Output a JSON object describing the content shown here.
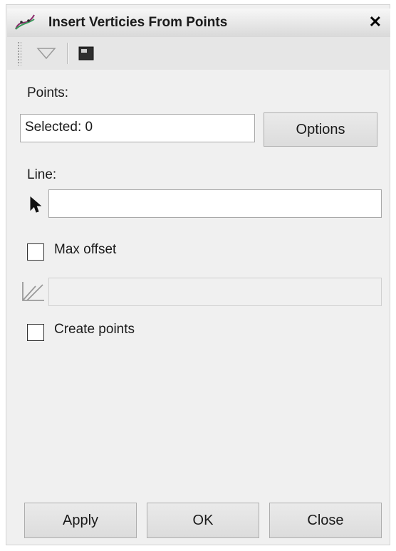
{
  "window": {
    "title": "Insert Verticies From Points",
    "close_glyph": "✕"
  },
  "icons": {
    "title": "line-points-icon",
    "toolbar_dropdown": "triangle-down-icon",
    "toolbar_console": "console-icon",
    "line_pick": "cursor-arrow-icon",
    "offset": "angle-icon",
    "close": "close-icon"
  },
  "points": {
    "label": "Points:",
    "value": "Selected: 0",
    "options_label": "Options"
  },
  "line": {
    "label": "Line:",
    "value": ""
  },
  "max_offset": {
    "label": "Max offset",
    "checked": false,
    "value": ""
  },
  "create_points": {
    "label": "Create points",
    "checked": false
  },
  "footer": {
    "apply_label": "Apply",
    "ok_label": "OK",
    "close_label": "Close"
  },
  "colors": {
    "window_bg": "#f0f0f0",
    "titlebar_bg": "#dcdcdc",
    "toolbar_bg": "#e6e6e6",
    "button_bg": "#e1e1e1",
    "border": "#adadad"
  }
}
